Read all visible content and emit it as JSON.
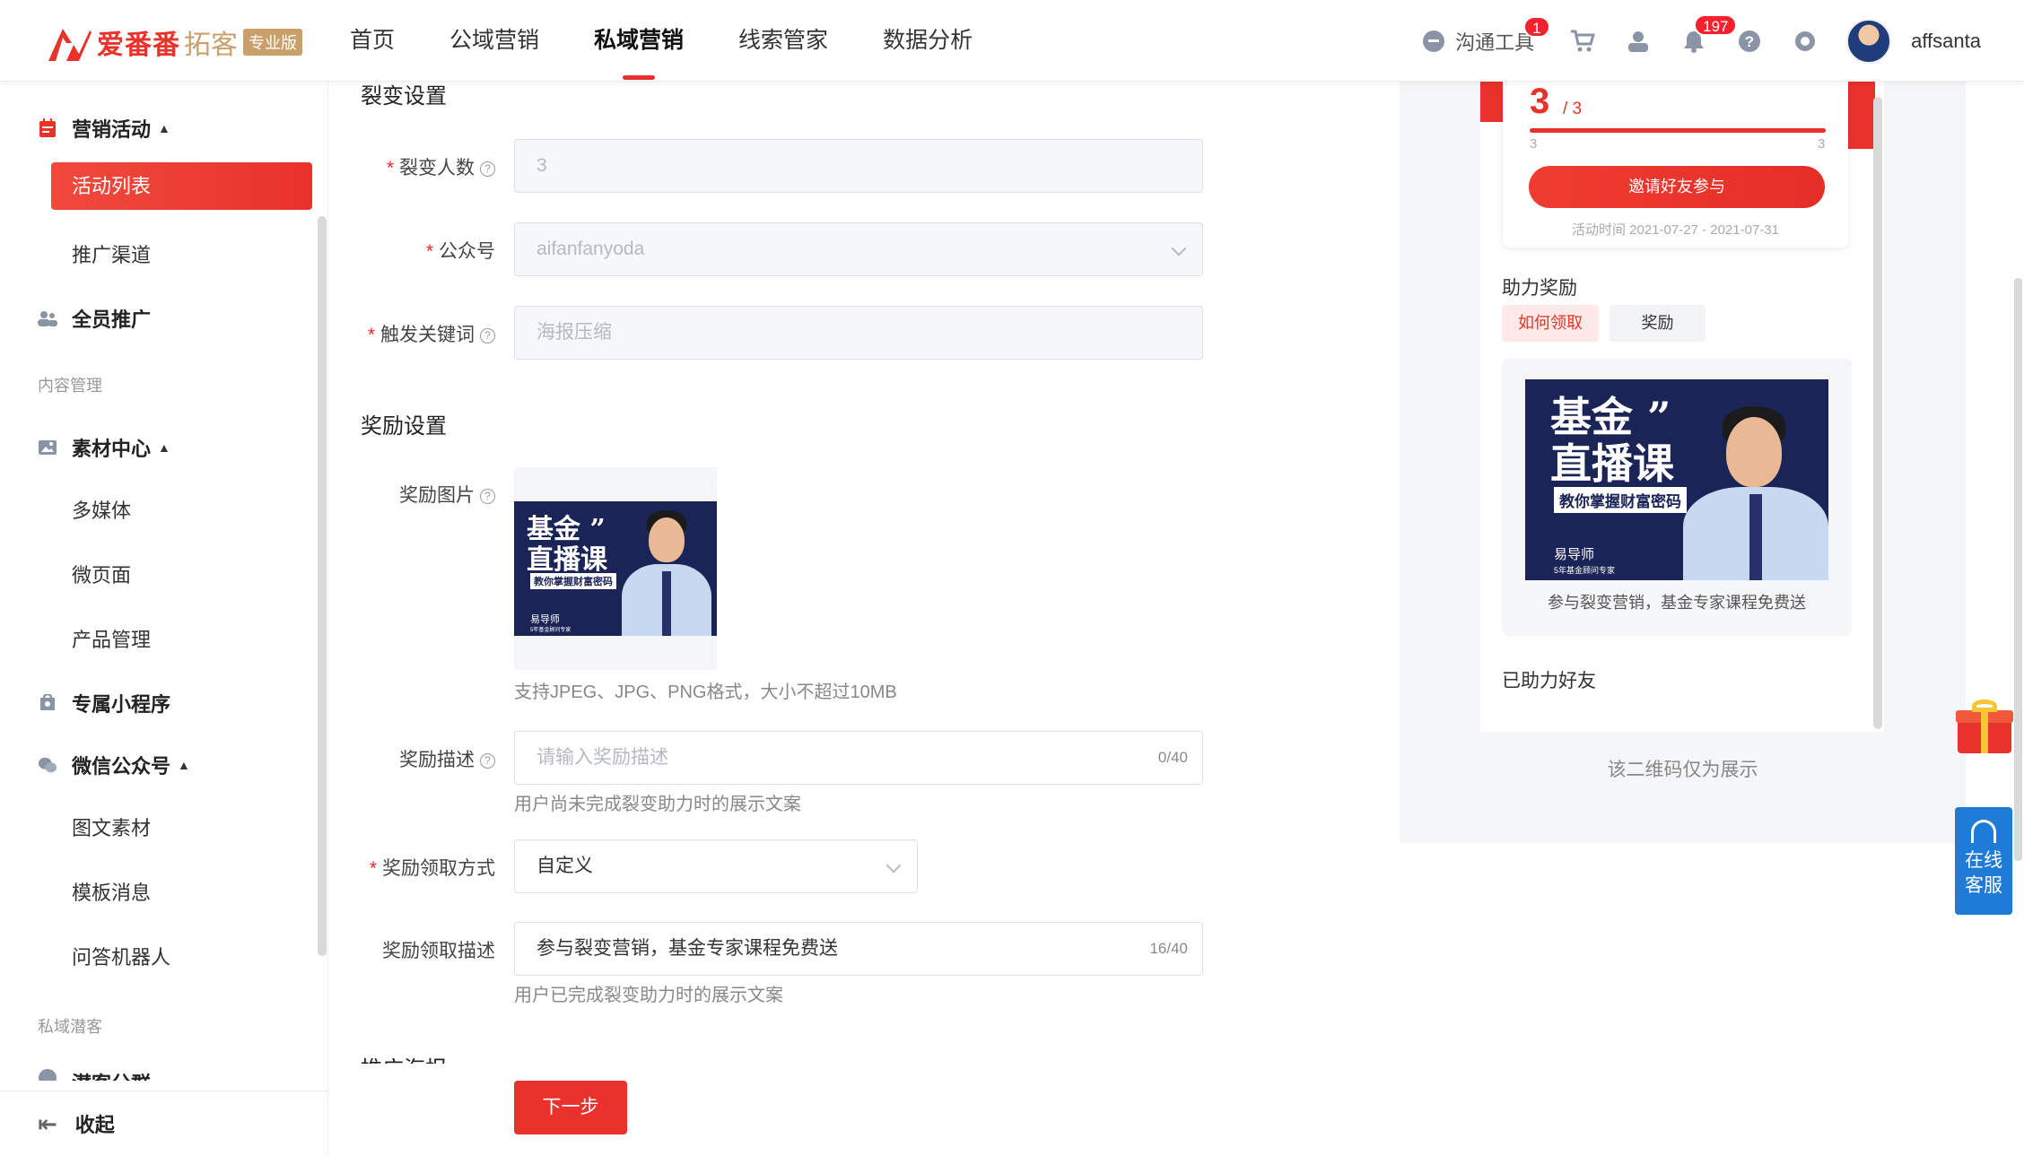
{
  "brand": {
    "name": "爱番番",
    "sub": "拓客",
    "badge": "专业版"
  },
  "nav": {
    "items": [
      "首页",
      "公域营销",
      "私域营销",
      "线索管家",
      "数据分析"
    ],
    "active_index": 2
  },
  "tools": {
    "comm_label": "沟通工具",
    "comm_badge": "1",
    "bell_badge": "197",
    "username": "affsanta"
  },
  "sidebar": {
    "marketing": "营销活动",
    "activity_list": "活动列表",
    "channels": "推广渠道",
    "all_staff": "全员推广",
    "content_section": "内容管理",
    "material": "素材中心",
    "multimedia": "多媒体",
    "micro_page": "微页面",
    "product": "产品管理",
    "mini_program": "专属小程序",
    "wechat": "微信公众号",
    "article": "图文素材",
    "template_msg": "模板消息",
    "qa_bot": "问答机器人",
    "private_section": "私域潜客",
    "partial": "潜客分群",
    "collapse": "收起"
  },
  "form": {
    "fission_title": "裂变设置",
    "fission_count_label": "裂变人数",
    "fission_count_value": "3",
    "account_label": "公众号",
    "account_value": "aifanfanyoda",
    "keyword_label": "触发关键词",
    "keyword_value": "海报压缩",
    "reward_title": "奖励设置",
    "reward_image_label": "奖励图片",
    "reward_image_hint": "支持JPEG、JPG、PNG格式，大小不超过10MB",
    "reward_desc_label": "奖励描述",
    "reward_desc_placeholder": "请输入奖励描述",
    "reward_desc_count": "0/40",
    "reward_desc_hint": "用户尚未完成裂变助力时的展示文案",
    "claim_method_label": "奖励领取方式",
    "claim_method_value": "自定义",
    "claim_desc_label": "奖励领取描述",
    "claim_desc_value": "参与裂变营销，基金专家课程免费送",
    "claim_desc_count": "16/40",
    "claim_desc_hint": "用户已完成裂变助力时的展示文案",
    "cut_section": "推广海报",
    "next_button": "下一步"
  },
  "poster": {
    "title_line1": "基金",
    "quote": "”",
    "title_line2": "直播课",
    "tag": "教你掌握财富密码",
    "name": "易导师",
    "role": "5年基金顾问专家"
  },
  "preview": {
    "progress_current": "3",
    "progress_total": "/ 3",
    "progress_min": "3",
    "progress_max": "3",
    "progress_fraction": 1.0,
    "invite_button": "邀请好友参与",
    "activity_time": "活动时间 2021-07-27 - 2021-07-31",
    "help_reward_title": "助力奖励",
    "tab_how": "如何领取",
    "tab_reward": "奖励",
    "reward_caption": "参与裂变营销，基金专家课程免费送",
    "helped_friends": "已助力好友",
    "qr_note": "该二维码仅为展示"
  },
  "widgets": {
    "service_line1": "在线",
    "service_line2": "客服"
  },
  "colors": {
    "accent": "#e8322b",
    "gold": "#c9a06a",
    "service_blue": "#1f7bd8"
  }
}
